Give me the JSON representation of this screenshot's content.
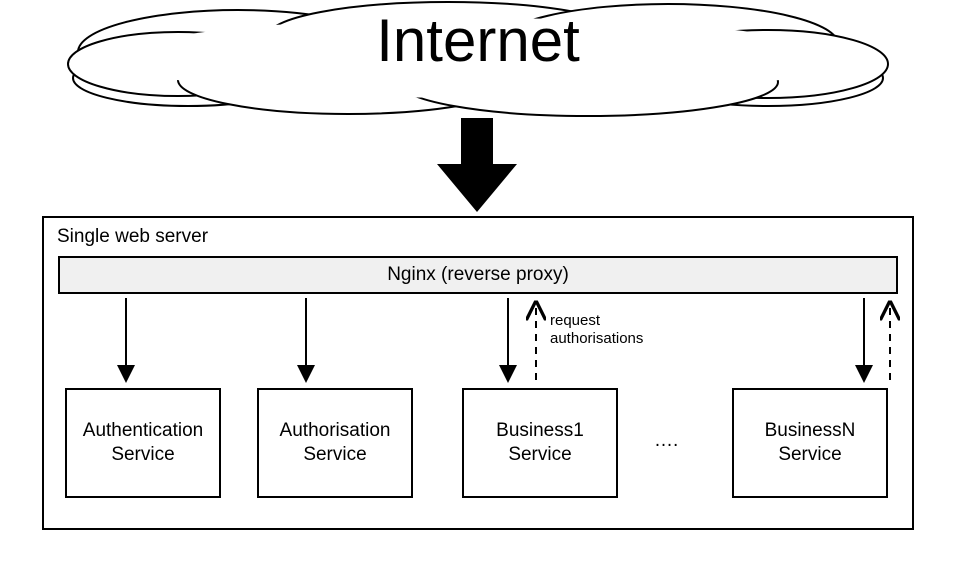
{
  "cloud": {
    "label": "Internet"
  },
  "server": {
    "title": "Single web server",
    "proxy_label": "Nginx (reverse proxy)",
    "request_label_line1": "request",
    "request_label_line2": "authorisations",
    "services": {
      "s1": "Authentication\nService",
      "s2": "Authorisation\nService",
      "s3": "Business1\nService",
      "ellipsis": "….",
      "s4": "BusinessN\nService"
    }
  }
}
